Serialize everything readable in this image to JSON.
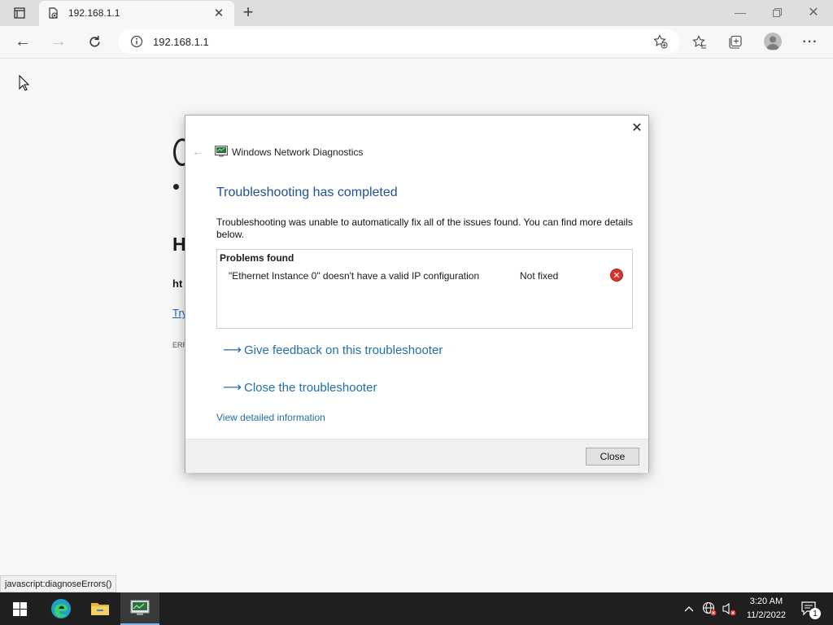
{
  "browser": {
    "tab_title": "192.168.1.1",
    "address": "192.168.1.1",
    "new_tab_glyph": "+",
    "icons": [
      "tab-actions-icon",
      "page-error-icon",
      "close-icon",
      "plus-icon",
      "back-icon",
      "forward-icon",
      "refresh-icon",
      "info-icon",
      "add-favorite-icon",
      "favorites-icon",
      "collections-icon",
      "profile-icon",
      "more-icon",
      "minimize-icon",
      "restore-icon",
      "window-close-icon"
    ]
  },
  "page": {
    "frag_heading": "H",
    "frag_url": "ht",
    "frag_link": "Try",
    "frag_error": "ERR"
  },
  "dialog": {
    "title": "Windows Network Diagnostics",
    "heading": "Troubleshooting has completed",
    "description": "Troubleshooting was unable to automatically fix all of the issues found. You can find more details below.",
    "problems_header": "Problems found",
    "problems": [
      {
        "description": "\"Ethernet Instance 0\" doesn't have a valid IP configuration",
        "status": "Not fixed"
      }
    ],
    "actions": [
      "Give feedback on this troubleshooter",
      "Close the troubleshooter"
    ],
    "detail_link": "View detailed information",
    "close_button": "Close",
    "accent_color": "#1f6fab",
    "heading_color": "#1e4e9c"
  },
  "statusbar": {
    "text": "javascript:diagnoseErrors()"
  },
  "taskbar": {
    "time": "3:20 AM",
    "date": "11/2/2022",
    "notification_count": "1"
  }
}
